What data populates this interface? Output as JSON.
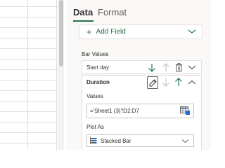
{
  "tabs": [
    {
      "label": "Data",
      "active": true
    },
    {
      "label": "Format",
      "active": false
    }
  ],
  "add_field": {
    "label": "Add Field"
  },
  "bar_values": {
    "section_label": "Bar Values",
    "fields": [
      {
        "label": "Start day"
      },
      {
        "label": "Duration",
        "values_label": "Values",
        "values": "='Sheet1 (3)'!D2:D7",
        "plot_as_label": "Plot As",
        "plot_as": "Stacked Bar"
      }
    ]
  },
  "colors": {
    "accent": "#217346",
    "icon_gray": "#605e5c",
    "disabled": "#c8c6c4"
  },
  "icons": [
    "plus-icon",
    "chevron-down-icon",
    "arrow-down-icon",
    "arrow-up-icon",
    "trash-icon",
    "chevron-up-icon",
    "pencil-icon",
    "range-select-icon",
    "stacked-bar-icon"
  ]
}
